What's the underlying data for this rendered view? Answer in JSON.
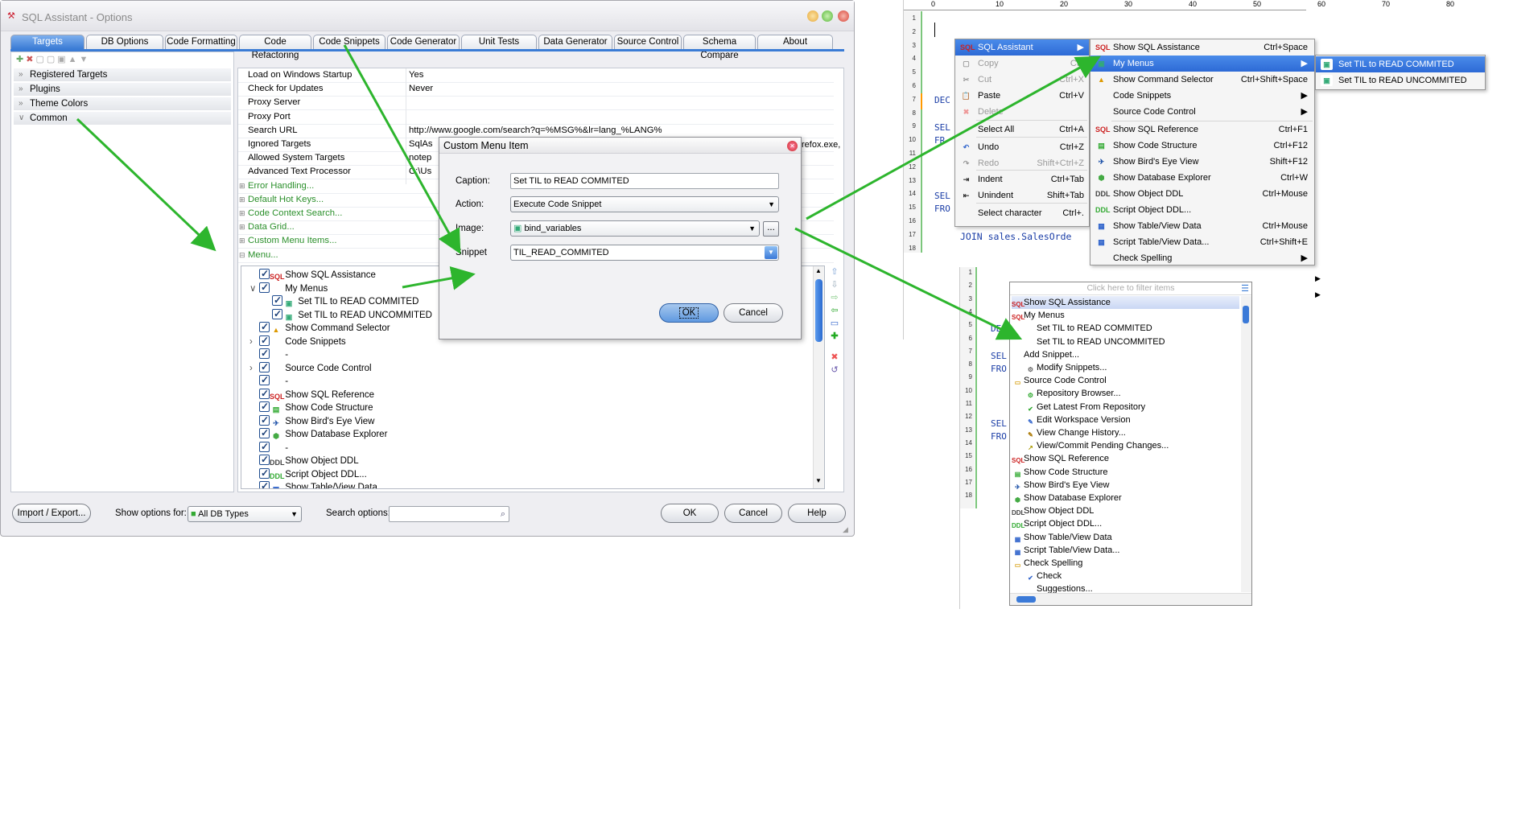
{
  "window": {
    "title": "SQL Assistant - Options"
  },
  "tabs": [
    "Targets",
    "DB Options",
    "Code Formatting",
    "Code Refactoring",
    "Code Snippets",
    "Code Generator",
    "Unit Tests",
    "Data Generator",
    "Source Control",
    "Schema Compare",
    "About"
  ],
  "left_items": [
    "Registered Targets",
    "Plugins",
    "Theme Colors",
    "Common"
  ],
  "grid": [
    {
      "k": "Load on Windows Startup",
      "v": "Yes"
    },
    {
      "k": "Check for Updates",
      "v": "Never"
    },
    {
      "k": "Proxy Server",
      "v": ""
    },
    {
      "k": "Proxy Port",
      "v": ""
    },
    {
      "k": "Search URL",
      "v": "http://www.google.com/search?q=%MSG%&lr=lang_%LANG%"
    },
    {
      "k": "Ignored Targets",
      "v": "SqlAs"
    },
    {
      "k": "Allowed System Targets",
      "v": "notep"
    },
    {
      "k": "Advanced Text Processor",
      "v": "C:\\Us"
    },
    {
      "k": "Error Handling...",
      "v": ""
    },
    {
      "k": "Default Hot Keys...",
      "v": ""
    },
    {
      "k": "Code Context Search...",
      "v": ""
    },
    {
      "k": "Data Grid...",
      "v": ""
    },
    {
      "k": "Custom Menu Items...",
      "v": ""
    },
    {
      "k": "Menu...",
      "v": ""
    }
  ],
  "grid_clipped_value": "refox.exe,",
  "menu_tree": [
    "Show SQL Assistance",
    "My Menus",
    "Set TIL to READ COMMITED",
    "Set TIL to READ UNCOMMITED",
    "Show Command Selector",
    "Code Snippets",
    "-",
    "Source Code Control",
    "-",
    "Show SQL Reference",
    "Show Code Structure",
    "Show Bird's Eye View",
    "Show Database Explorer",
    "-",
    "Show Object DDL",
    "Script Object DDL...",
    "Show Table/View Data"
  ],
  "bottom": {
    "import": "Import / Export...",
    "show_for": "Show options for:",
    "db_types": "All DB Types",
    "search": "Search options:",
    "ok": "OK",
    "cancel": "Cancel",
    "help": "Help"
  },
  "dialog": {
    "title": "Custom Menu Item",
    "caption_label": "Caption:",
    "caption_value": "Set TIL to READ COMMITED",
    "action_label": "Action:",
    "action_value": "Execute Code Snippet",
    "image_label": "Image:",
    "image_value": "bind_variables",
    "snippet_label": "Snippet",
    "snippet_value": "TIL_READ_COMMITED",
    "ok": "OK",
    "cancel": "Cancel",
    "browse": "..."
  },
  "ruler": [
    "0",
    "10",
    "20",
    "30",
    "40",
    "50",
    "60",
    "70",
    "80"
  ],
  "editor_lines": [
    "1",
    "2",
    "3",
    "4",
    "5",
    "6",
    "7",
    "8",
    "9",
    "10",
    "11",
    "12",
    "13",
    "14",
    "15",
    "16",
    "17",
    "18"
  ],
  "editor_code": {
    "dec": "DEC",
    "sel1": "SEL",
    "fro1": "FR",
    "sel2": "SEL",
    "fro2": "FRO",
    "join": "JOIN sales.SalesOrde"
  },
  "ctx_menu": [
    {
      "t": "SQL Assistant",
      "s": "▶",
      "dis": false,
      "hl": true
    },
    {
      "t": "Copy",
      "s": "Ctrl",
      "dis": true
    },
    {
      "t": "Cut",
      "s": "Ctrl+X",
      "dis": true
    },
    {
      "t": "Paste",
      "s": "Ctrl+V",
      "dis": false
    },
    {
      "t": "Delete",
      "s": "",
      "dis": true
    },
    {
      "t": "Select All",
      "s": "Ctrl+A",
      "dis": false
    },
    {
      "t": "Undo",
      "s": "Ctrl+Z",
      "dis": false
    },
    {
      "t": "Redo",
      "s": "Shift+Ctrl+Z",
      "dis": true
    },
    {
      "t": "Indent",
      "s": "Ctrl+Tab",
      "dis": false
    },
    {
      "t": "Unindent",
      "s": "Shift+Tab",
      "dis": false
    },
    {
      "t": "Select character",
      "s": "Ctrl+.",
      "dis": false
    }
  ],
  "sub_menu": [
    {
      "t": "Show SQL Assistance",
      "s": "Ctrl+Space"
    },
    {
      "t": "My Menus",
      "s": "▶",
      "hl": true
    },
    {
      "t": "Show Command Selector",
      "s": "Ctrl+Shift+Space"
    },
    {
      "t": "Code Snippets",
      "s": "▶"
    },
    {
      "t": "Source Code Control",
      "s": "▶"
    },
    {
      "t": "Show SQL Reference",
      "s": "Ctrl+F1"
    },
    {
      "t": "Show Code Structure",
      "s": "Ctrl+F12"
    },
    {
      "t": "Show Bird's Eye View",
      "s": "Shift+F12"
    },
    {
      "t": "Show Database Explorer",
      "s": "Ctrl+W"
    },
    {
      "t": "Show Object DDL",
      "s": "Ctrl+Mouse"
    },
    {
      "t": "Script Object DDL...",
      "s": ""
    },
    {
      "t": "Show Table/View Data",
      "s": "Ctrl+Mouse"
    },
    {
      "t": "Script Table/View Data...",
      "s": "Ctrl+Shift+E"
    },
    {
      "t": "Check Spelling",
      "s": "▶"
    }
  ],
  "sub_menu2": [
    "Set TIL to READ COMMITED",
    "Set TIL to READ UNCOMMITED"
  ],
  "extra_arrows": [
    "▶",
    "▶"
  ],
  "list_panel": {
    "filter_placeholder": "Click here to filter items",
    "items": [
      {
        "t": "Show SQL Assistance",
        "ind": 0
      },
      {
        "t": "My Menus",
        "ind": 0
      },
      {
        "t": "Set TIL to READ COMMITED",
        "ind": 1
      },
      {
        "t": "Set TIL to READ UNCOMMITED",
        "ind": 1
      },
      {
        "t": "Add Snippet...",
        "ind": 0
      },
      {
        "t": "Modify Snippets...",
        "ind": 1
      },
      {
        "t": "Source Code Control",
        "ind": 0
      },
      {
        "t": "Repository Browser...",
        "ind": 1
      },
      {
        "t": "Get Latest From Repository",
        "ind": 1
      },
      {
        "t": "Edit Workspace Version",
        "ind": 1
      },
      {
        "t": "View Change History...",
        "ind": 1
      },
      {
        "t": "View/Commit Pending Changes...",
        "ind": 1
      },
      {
        "t": "Show SQL Reference",
        "ind": 0
      },
      {
        "t": "Show Code Structure",
        "ind": 0
      },
      {
        "t": "Show Bird's Eye View",
        "ind": 0
      },
      {
        "t": "Show Database Explorer",
        "ind": 0
      },
      {
        "t": "Show Object DDL",
        "ind": 0
      },
      {
        "t": "Script Object DDL...",
        "ind": 0
      },
      {
        "t": "Show Table/View Data",
        "ind": 0
      },
      {
        "t": "Script Table/View Data...",
        "ind": 0
      },
      {
        "t": "Check Spelling",
        "ind": 0
      },
      {
        "t": "Check",
        "ind": 1
      },
      {
        "t": "Suggestions...",
        "ind": 1
      }
    ]
  },
  "colors": {
    "accent": "#3a7bd5",
    "arrow": "#2db52d",
    "highlight": "#2d6ad6"
  }
}
